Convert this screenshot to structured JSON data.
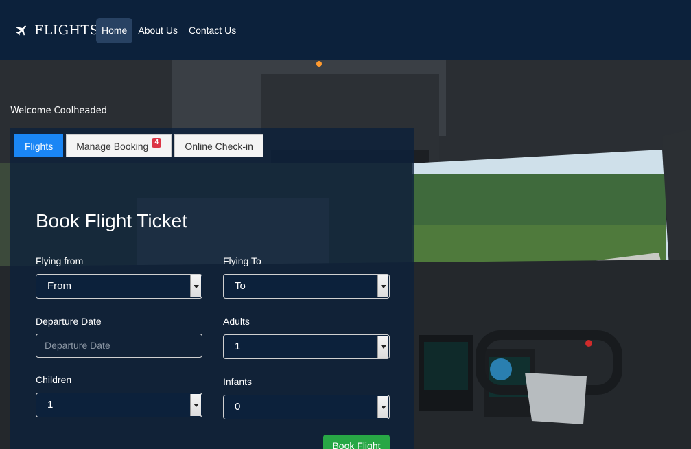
{
  "navbar": {
    "brand": "FLIGHTS",
    "links": [
      {
        "label": "Home",
        "active": true
      },
      {
        "label": "About Us"
      },
      {
        "label": "Contact Us"
      }
    ]
  },
  "welcome": "Welcome Coolheaded",
  "tabs": [
    {
      "label": "Flights",
      "active": true
    },
    {
      "label": "Manage Booking",
      "badge": "4"
    },
    {
      "label": "Online Check-in"
    }
  ],
  "form": {
    "title": "Book Flight Ticket",
    "flying_from": {
      "label": "Flying from",
      "value": "From"
    },
    "flying_to": {
      "label": "Flying To",
      "value": "To"
    },
    "departure": {
      "label": "Departure Date",
      "placeholder": "Departure Date"
    },
    "adults": {
      "label": "Adults",
      "value": "1"
    },
    "children": {
      "label": "Children",
      "value": "1"
    },
    "infants": {
      "label": "Infants",
      "value": "0"
    },
    "submit": "Book Flight"
  },
  "colors": {
    "navbar": "#0c213b",
    "active_tab": "#1a86f5",
    "badge": "#dc3545",
    "submit": "#28a745"
  },
  "icons": {
    "brand": "airplane-icon"
  }
}
